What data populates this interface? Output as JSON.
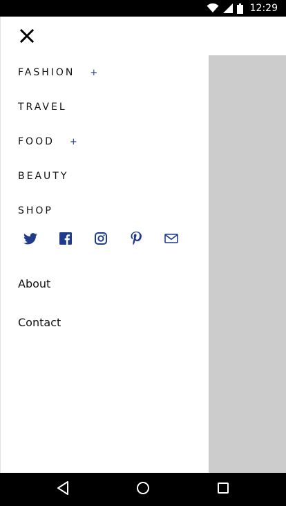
{
  "status_bar": {
    "time": "12:29",
    "icons": [
      "wifi-icon",
      "signal-icon",
      "battery-icon"
    ]
  },
  "drawer": {
    "close_icon": "close-icon",
    "nav_items": [
      {
        "label": "FASHION",
        "has_submenu": true,
        "expand_symbol": "+"
      },
      {
        "label": "TRAVEL",
        "has_submenu": false
      },
      {
        "label": "FOOD",
        "has_submenu": true,
        "expand_symbol": "+"
      },
      {
        "label": "BEAUTY",
        "has_submenu": false
      },
      {
        "label": "SHOP",
        "has_submenu": false
      }
    ],
    "social_icons": [
      "twitter-icon",
      "facebook-icon",
      "instagram-icon",
      "pinterest-icon",
      "mail-icon"
    ],
    "secondary_links": [
      {
        "label": "About"
      },
      {
        "label": "Contact"
      }
    ]
  },
  "nav_bar": {
    "buttons": [
      "back-icon",
      "home-icon",
      "recents-icon"
    ]
  },
  "colors": {
    "accent": "#1f3b8c",
    "scrim": "#cccccc",
    "text": "#111111"
  }
}
